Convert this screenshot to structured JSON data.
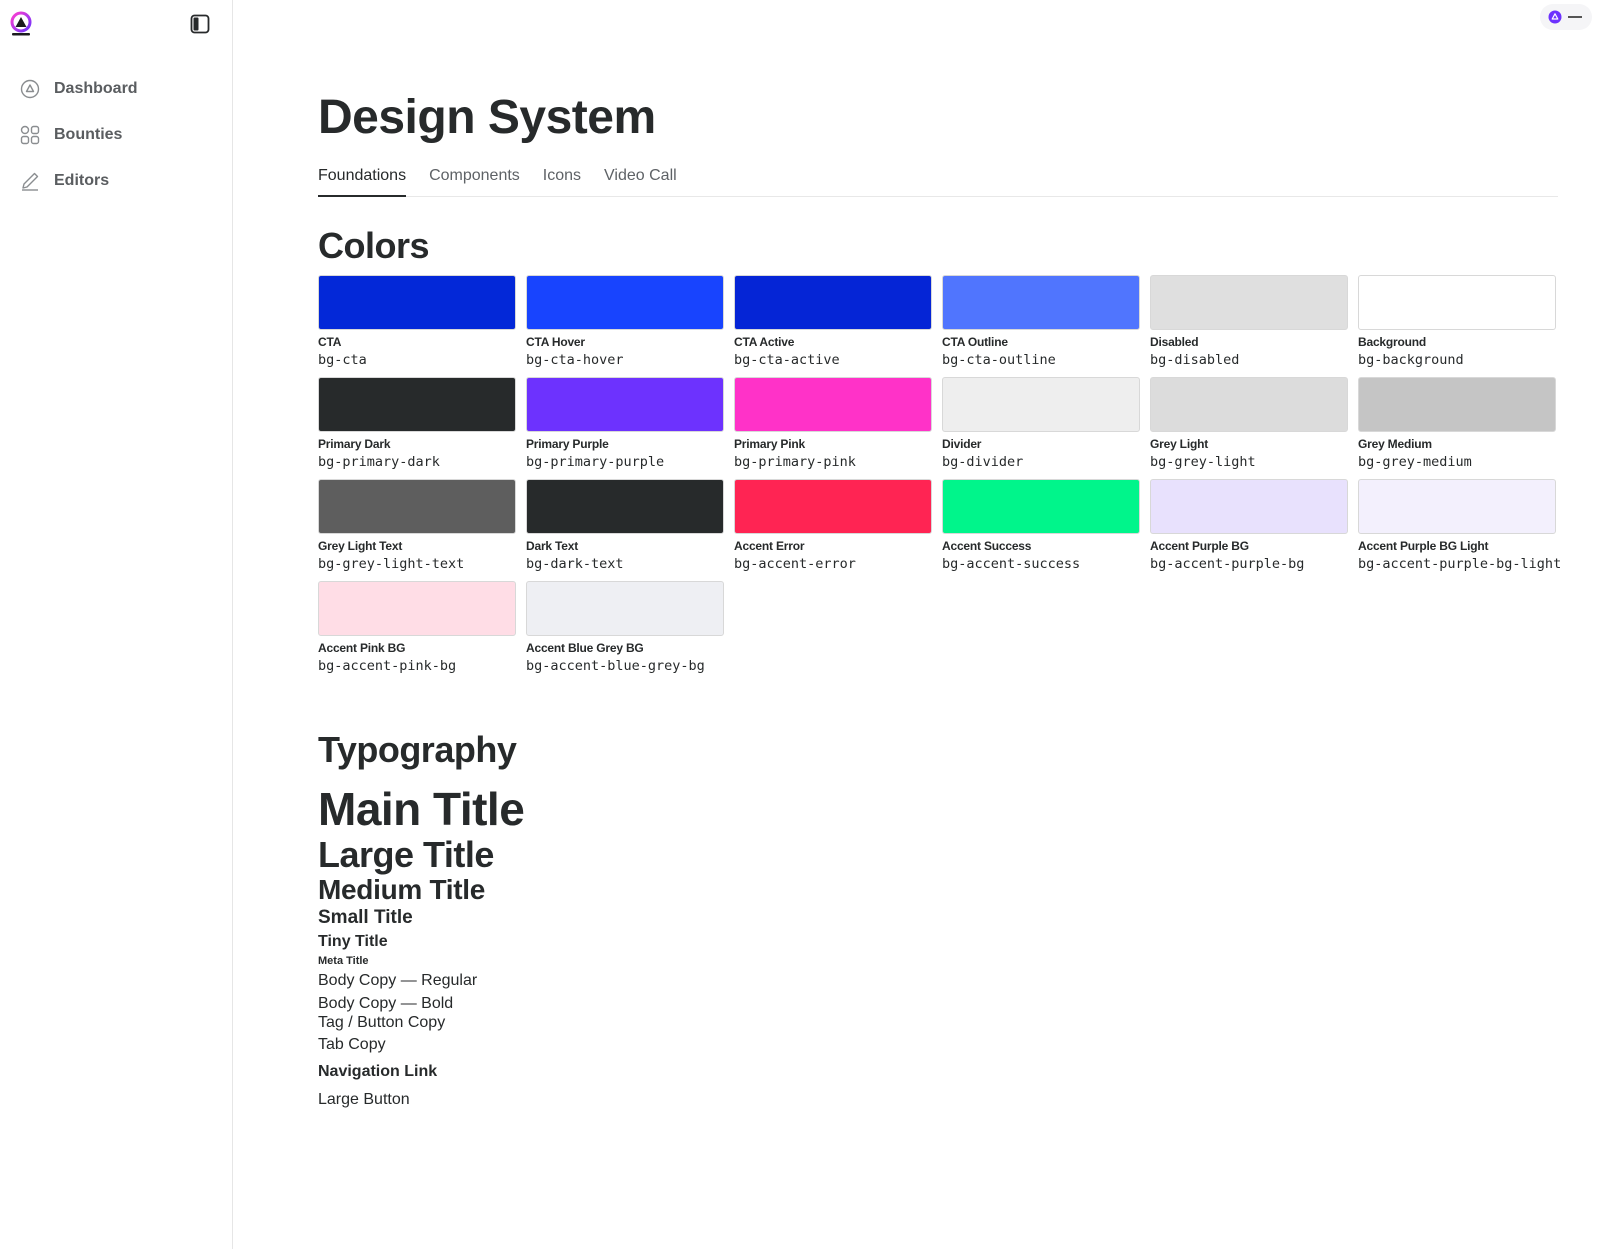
{
  "sidebar": {
    "items": [
      {
        "label": "Dashboard",
        "icon": "dashboard-icon"
      },
      {
        "label": "Bounties",
        "icon": "grid-icon"
      },
      {
        "label": "Editors",
        "icon": "pencil-icon"
      }
    ]
  },
  "page": {
    "title": "Design System",
    "tabs": [
      "Foundations",
      "Components",
      "Icons",
      "Video Call"
    ],
    "active_tab": "Foundations"
  },
  "colors": {
    "heading": "Colors",
    "swatches": [
      {
        "name": "CTA",
        "class": "bg-cta",
        "color": "#0328d8"
      },
      {
        "name": "CTA Hover",
        "class": "bg-cta-hover",
        "color": "#1844fe"
      },
      {
        "name": "CTA Active",
        "class": "bg-cta-active",
        "color": "#0525d6"
      },
      {
        "name": "CTA Outline",
        "class": "bg-cta-outline",
        "color": "#5075fe"
      },
      {
        "name": "Disabled",
        "class": "bg-disabled",
        "color": "#dfdfdf"
      },
      {
        "name": "Background",
        "class": "bg-background",
        "color": "#ffffff"
      },
      {
        "name": "Primary Dark",
        "class": "bg-primary-dark",
        "color": "#272a2b"
      },
      {
        "name": "Primary Purple",
        "class": "bg-primary-purple",
        "color": "#6d32fe"
      },
      {
        "name": "Primary Pink",
        "class": "bg-primary-pink",
        "color": "#ff32c8"
      },
      {
        "name": "Divider",
        "class": "bg-divider",
        "color": "#eeeeee"
      },
      {
        "name": "Grey Light",
        "class": "bg-grey-light",
        "color": "#dcdcdc"
      },
      {
        "name": "Grey Medium",
        "class": "bg-grey-medium",
        "color": "#c5c5c5"
      },
      {
        "name": "Grey Light Text",
        "class": "bg-grey-light-text",
        "color": "#5e5e5e"
      },
      {
        "name": "Dark Text",
        "class": "bg-dark-text",
        "color": "#272a2b"
      },
      {
        "name": "Accent Error",
        "class": "bg-accent-error",
        "color": "#ff2453"
      },
      {
        "name": "Accent Success",
        "class": "bg-accent-success",
        "color": "#00f58b"
      },
      {
        "name": "Accent Purple BG",
        "class": "bg-accent-purple-bg",
        "color": "#e8e1fd"
      },
      {
        "name": "Accent Purple BG Light",
        "class": "bg-accent-purple-bg-light",
        "color": "#f3f0fd"
      },
      {
        "name": "Accent Pink BG",
        "class": "bg-accent-pink-bg",
        "color": "#ffdde6"
      },
      {
        "name": "Accent Blue Grey BG",
        "class": "bg-accent-blue-grey-bg",
        "color": "#eeeff3"
      }
    ]
  },
  "typography": {
    "heading": "Typography",
    "main_title": "Main Title",
    "large_title": "Large Title",
    "medium_title": "Medium Title",
    "small_title": "Small Title",
    "tiny_title": "Tiny Title",
    "meta_title": "Meta Title",
    "body_regular": "Body Copy — Regular",
    "body_bold": "Body Copy — Bold",
    "tag_button": "Tag / Button Copy",
    "tab_copy": "Tab Copy",
    "nav_link": "Navigation Link",
    "large_button": "Large Button"
  }
}
